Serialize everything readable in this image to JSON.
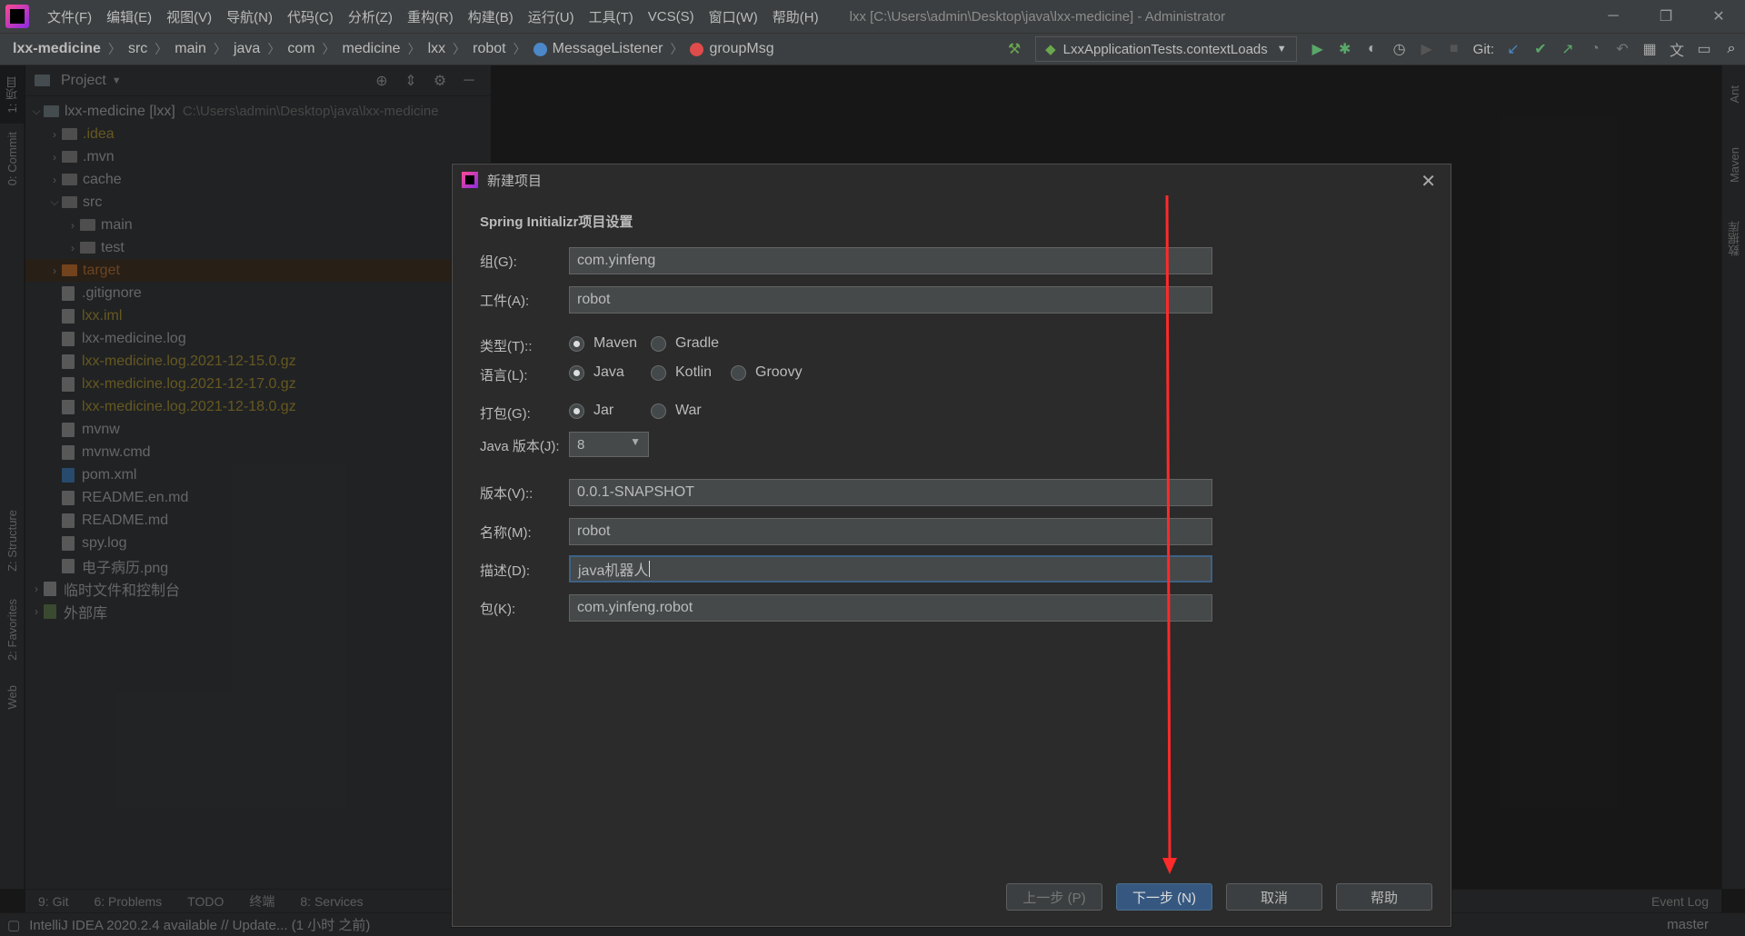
{
  "menubar": {
    "items": [
      "文件(F)",
      "编辑(E)",
      "视图(V)",
      "导航(N)",
      "代码(C)",
      "分析(Z)",
      "重构(R)",
      "构建(B)",
      "运行(U)",
      "工具(T)",
      "VCS(S)",
      "窗口(W)",
      "帮助(H)"
    ],
    "window_title": "lxx [C:\\Users\\admin\\Desktop\\java\\lxx-medicine] - Administrator"
  },
  "navbar": {
    "breadcrumbs": [
      "lxx-medicine",
      "src",
      "main",
      "java",
      "com",
      "medicine",
      "lxx",
      "robot",
      "MessageListener",
      "groupMsg"
    ],
    "run_config": "LxxApplicationTests.contextLoads",
    "git_label": "Git:"
  },
  "leftstrip": {
    "tabs": [
      "1: 项目",
      "0: Commit",
      "Z: Structure",
      "2: Favorites",
      "Web"
    ]
  },
  "rightstrip": {
    "tabs": [
      "Ant",
      "Maven",
      "数据库"
    ]
  },
  "project": {
    "title": "Project",
    "root": {
      "name": "lxx-medicine [lxx]",
      "path": "C:\\Users\\admin\\Desktop\\java\\lxx-medicine"
    },
    "items": [
      {
        "name": ".idea"
      },
      {
        "name": ".mvn"
      },
      {
        "name": "cache"
      },
      {
        "name": "src"
      },
      {
        "name": "main"
      },
      {
        "name": "test"
      },
      {
        "name": "target"
      },
      {
        "name": ".gitignore"
      },
      {
        "name": "lxx.iml"
      },
      {
        "name": "lxx-medicine.log"
      },
      {
        "name": "lxx-medicine.log.2021-12-15.0.gz"
      },
      {
        "name": "lxx-medicine.log.2021-12-17.0.gz"
      },
      {
        "name": "lxx-medicine.log.2021-12-18.0.gz"
      },
      {
        "name": "mvnw"
      },
      {
        "name": "mvnw.cmd"
      },
      {
        "name": "pom.xml"
      },
      {
        "name": "README.en.md"
      },
      {
        "name": "README.md"
      },
      {
        "name": "spy.log"
      },
      {
        "name": "电子病历.png"
      },
      {
        "name": "临时文件和控制台"
      },
      {
        "name": "外部库"
      }
    ]
  },
  "toolwindows": [
    "9: Git",
    "6: Problems",
    "TODO",
    "终端",
    "8: Services",
    "Event Log"
  ],
  "statusbar": {
    "message": "IntelliJ IDEA 2020.2.4 available // Update... (1 小时 之前)",
    "branch": "master"
  },
  "dialog": {
    "title": "新建项目",
    "section": "Spring Initializr项目设置",
    "group_label": "组(G):",
    "group_value": "com.yinfeng",
    "artifact_label": "工件(A):",
    "artifact_value": "robot",
    "type_label": "类型(T)::",
    "type_options": [
      "Maven",
      "Gradle"
    ],
    "lang_label": "语言(L):",
    "lang_options": [
      "Java",
      "Kotlin",
      "Groovy"
    ],
    "pack_label": "打包(G):",
    "pack_options": [
      "Jar",
      "War"
    ],
    "java_label": "Java 版本(J):",
    "java_value": "8",
    "version_label": "版本(V)::",
    "version_value": "0.0.1-SNAPSHOT",
    "name_label": "名称(M):",
    "name_value": "robot",
    "desc_label": "描述(D):",
    "desc_value": "java机器人",
    "package_label": "包(K):",
    "package_value": "com.yinfeng.robot",
    "buttons": {
      "prev": "上一步 (P)",
      "next": "下一步 (N)",
      "cancel": "取消",
      "help": "帮助"
    }
  },
  "colors": {
    "annotation_arrow": "#ff2a2a",
    "primary_button": "#365880"
  }
}
